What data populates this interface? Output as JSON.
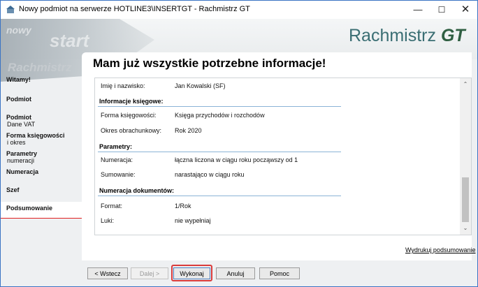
{
  "window": {
    "title": "Nowy podmiot na serwerze HOTLINE3\\INSERTGT - Rachmistrz GT",
    "controls": {
      "minimize": "—",
      "maximize": "☐",
      "close": "✕"
    }
  },
  "banner": {
    "logo_text": "Rachmistrz",
    "logo_suffix": "GT",
    "swoosh_start": "start",
    "swoosh_small": "nowy",
    "swoosh_brand": "Rachmistrz"
  },
  "sidebar": {
    "items": [
      {
        "label": "Witamy!",
        "sub": ""
      },
      {
        "label": "Podmiot",
        "sub": ""
      },
      {
        "label": "Podmiot",
        "sub": "Dane VAT"
      },
      {
        "label": "Forma księgowości",
        "sub": "i okres"
      },
      {
        "label": "Parametry",
        "sub": "numeracji"
      },
      {
        "label": "Numeracja",
        "sub": ""
      },
      {
        "label": "Szef",
        "sub": ""
      },
      {
        "label": "Podsumowanie",
        "sub": ""
      }
    ],
    "active_index": 7
  },
  "main": {
    "heading": "Mam już wszystkie potrzebne informacje!",
    "summary": {
      "row_name": {
        "label": "Imię i nazwisko:",
        "value": "Jan Kowalski (SF)"
      },
      "section_accounting": "Informacje księgowe:",
      "row_form": {
        "label": "Forma księgowości:",
        "value": "Księga przychodów i rozchodów"
      },
      "row_period": {
        "label": "Okres obrachunkowy:",
        "value": "Rok 2020"
      },
      "section_params": "Parametry:",
      "row_numbering": {
        "label": "Numeracja:",
        "value": "łączna liczona w ciągu roku począwszy od 1"
      },
      "row_summing": {
        "label": "Sumowanie:",
        "value": "narastająco w ciągu roku"
      },
      "section_docs": "Numeracja dokumentów:",
      "row_format": {
        "label": "Format:",
        "value": "1/Rok"
      },
      "row_gaps": {
        "label": "Luki:",
        "value": "nie wypełniaj"
      }
    },
    "print_link": "Wydrukuj podsumowanie"
  },
  "buttons": {
    "back": "< Wstecz",
    "next": "Dalej >",
    "execute": "Wykonaj",
    "cancel": "Anuluj",
    "help": "Pomoc"
  },
  "colors": {
    "accent_red": "#d93b3b",
    "section_rule": "#8ab3d6",
    "logo": "#3a6e73"
  }
}
